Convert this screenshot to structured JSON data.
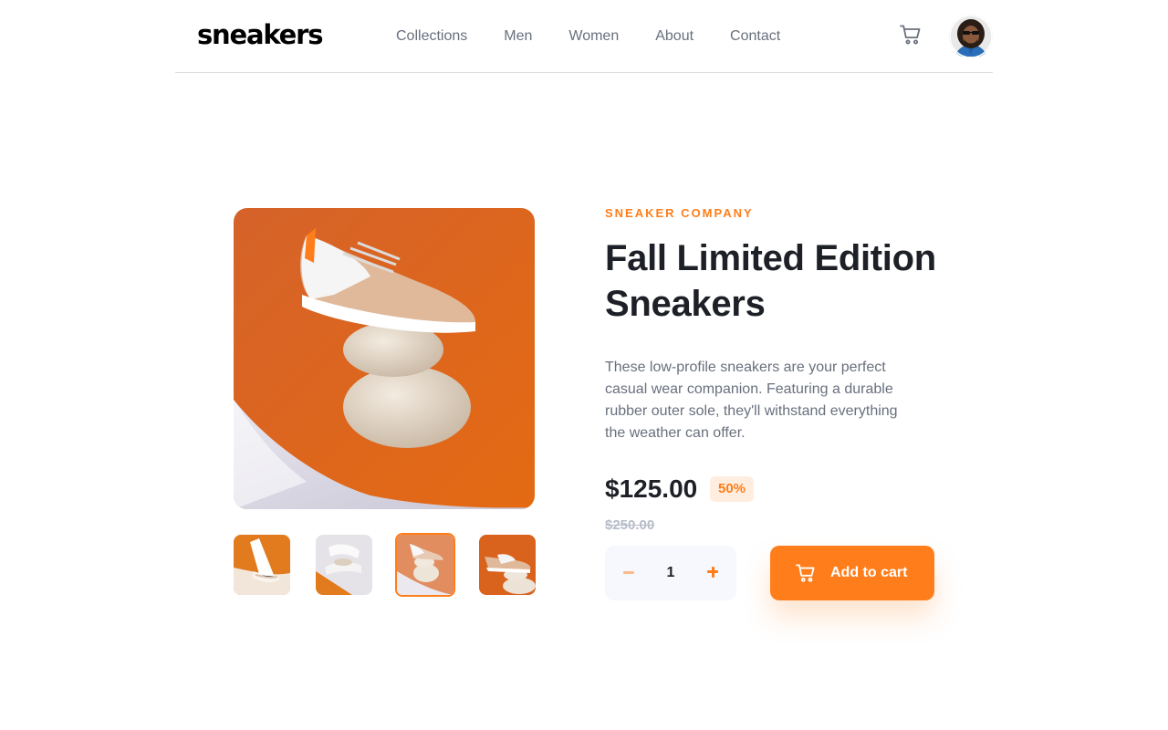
{
  "header": {
    "logo": "sneakers",
    "nav": [
      "Collections",
      "Men",
      "Women",
      "About",
      "Contact"
    ],
    "cart_icon": "cart-icon",
    "avatar_icon": "avatar"
  },
  "gallery": {
    "active_thumbnail": 3,
    "thumbnail_count": 4
  },
  "product": {
    "company": "SNEAKER COMPANY",
    "title": "Fall Limited Edition Sneakers",
    "description": "These low-profile sneakers are your perfect casual wear companion. Featuring a durable rubber outer sole, they'll withstand everything the weather can offer.",
    "price": "$125.00",
    "discount": "50%",
    "original_price": "$250.00"
  },
  "cart_controls": {
    "minus_icon": "minus-icon",
    "quantity": "1",
    "plus_icon": "plus-icon",
    "add_label": "Add to cart"
  },
  "colors": {
    "accent": "#ff7e1b",
    "accent_pale": "#ffede0",
    "text_dark": "#1d2026",
    "text_gray": "#69707d",
    "text_light": "#b6bcc8",
    "qty_bg": "#f6f8fd"
  }
}
